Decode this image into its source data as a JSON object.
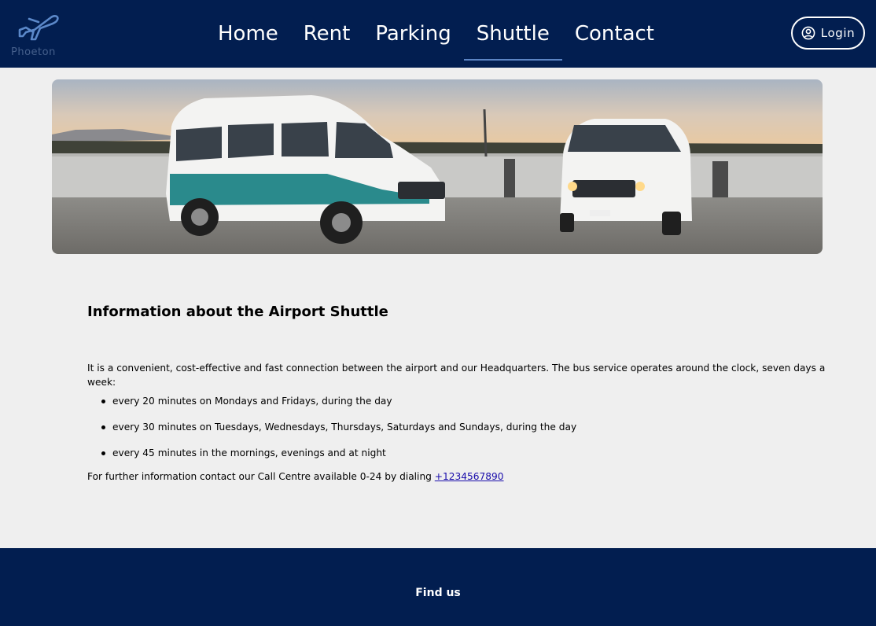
{
  "brand": {
    "name": "Phoeton"
  },
  "nav": {
    "items": [
      {
        "label": "Home"
      },
      {
        "label": "Rent"
      },
      {
        "label": "Parking"
      },
      {
        "label": "Shuttle"
      },
      {
        "label": "Contact"
      }
    ],
    "active": "Shuttle"
  },
  "login": {
    "label": "Login",
    "icon": "user-circle-icon"
  },
  "hero": {
    "alt_subject": "airport shuttle vans on rooftop parking"
  },
  "content": {
    "heading": "Information about the Airport Shuttle",
    "intro": "It is a convenient, cost-effective and fast connection between the airport and our Headquarters. The bus service operates around the clock, seven days a week:",
    "bullets": [
      "every 20 minutes on Mondays and Fridays, during the day",
      "every 30 minutes on Tuesdays, Wednesdays, Thursdays, Saturdays and Sundays, during the day",
      "every 45 minutes in the mornings, evenings and at night"
    ],
    "contact_prefix": "For further information contact our Call Centre available 0-24 by dialing ",
    "phone": "+1234567890"
  },
  "footer": {
    "title": "Find us"
  },
  "colors": {
    "navy": "#021e50",
    "page_bg": "#efefef",
    "link": "#1a0dab",
    "active_underline": "#5b84c4"
  }
}
